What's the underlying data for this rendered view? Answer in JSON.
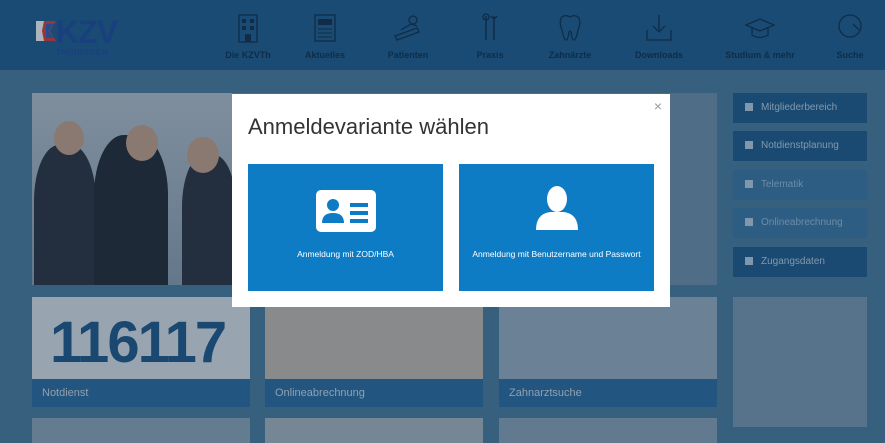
{
  "logo": {
    "text": "KZV",
    "subtext": "THÜRINGEN"
  },
  "nav": [
    {
      "label": "Die KZVTh",
      "icon": "building-icon"
    },
    {
      "label": "Aktuelles",
      "icon": "newspaper-icon"
    },
    {
      "label": "Patienten",
      "icon": "patient-icon"
    },
    {
      "label": "Praxis",
      "icon": "dental-tools-icon"
    },
    {
      "label": "Zahnärzte",
      "icon": "tooth-icon"
    },
    {
      "label": "Downloads",
      "icon": "download-icon"
    },
    {
      "label": "Studium & mehr",
      "icon": "graduation-cap-icon"
    },
    {
      "label": "Suche",
      "icon": "search-icon"
    }
  ],
  "sidebar": [
    {
      "label": "Mitgliederbereich",
      "icon": "user-icon"
    },
    {
      "label": "Notdienstplanung",
      "icon": "calendar-icon"
    },
    {
      "label": "Telematik",
      "icon": "monitor-icon"
    },
    {
      "label": "Onlineabrechnung",
      "icon": "list-icon"
    },
    {
      "label": "Zugangsdaten",
      "icon": "key-icon"
    }
  ],
  "tiles": [
    {
      "caption": "Notdienst",
      "number": "116117"
    },
    {
      "caption": "Onlineabrechnung"
    },
    {
      "caption": "Zahnarztsuche"
    }
  ],
  "modal": {
    "title": "Anmeldevariante wählen",
    "close": "×",
    "options": [
      {
        "label": "Anmeldung mit ZOD/HBA",
        "icon": "id-card-icon"
      },
      {
        "label": "Anmeldung mit Benutzername und Passwort",
        "icon": "user-silhouette-icon"
      }
    ]
  },
  "colors": {
    "primary": "#0d7cc4",
    "nav_bg": "#1d5f92",
    "modal_bg": "#ffffff"
  }
}
